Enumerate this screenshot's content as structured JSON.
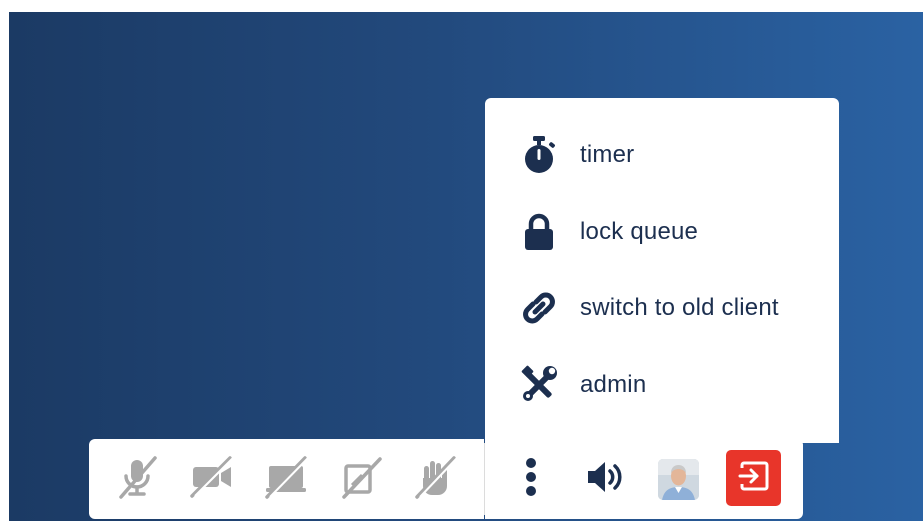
{
  "menu": {
    "items": [
      {
        "label": "timer",
        "icon": "stopwatch-icon"
      },
      {
        "label": "lock queue",
        "icon": "lock-icon"
      },
      {
        "label": "switch to old client",
        "icon": "link-icon"
      },
      {
        "label": "admin",
        "icon": "tools-icon"
      }
    ]
  },
  "toolbar": {
    "disabled_buttons": [
      {
        "icon": "microphone-slash-icon"
      },
      {
        "icon": "video-slash-icon"
      },
      {
        "icon": "screenshare-slash-icon"
      },
      {
        "icon": "whiteboard-slash-icon"
      },
      {
        "icon": "hand-slash-icon"
      }
    ],
    "more_icon": "more-vertical-icon",
    "speaker_icon": "volume-icon",
    "leave_icon": "sign-out-icon"
  },
  "colors": {
    "menu_text": "#1c2f4f",
    "disabled_icon": "#a8a8a8",
    "leave_button": "#e8352a",
    "background_start": "#1b3a64",
    "background_end": "#2a62a3"
  }
}
